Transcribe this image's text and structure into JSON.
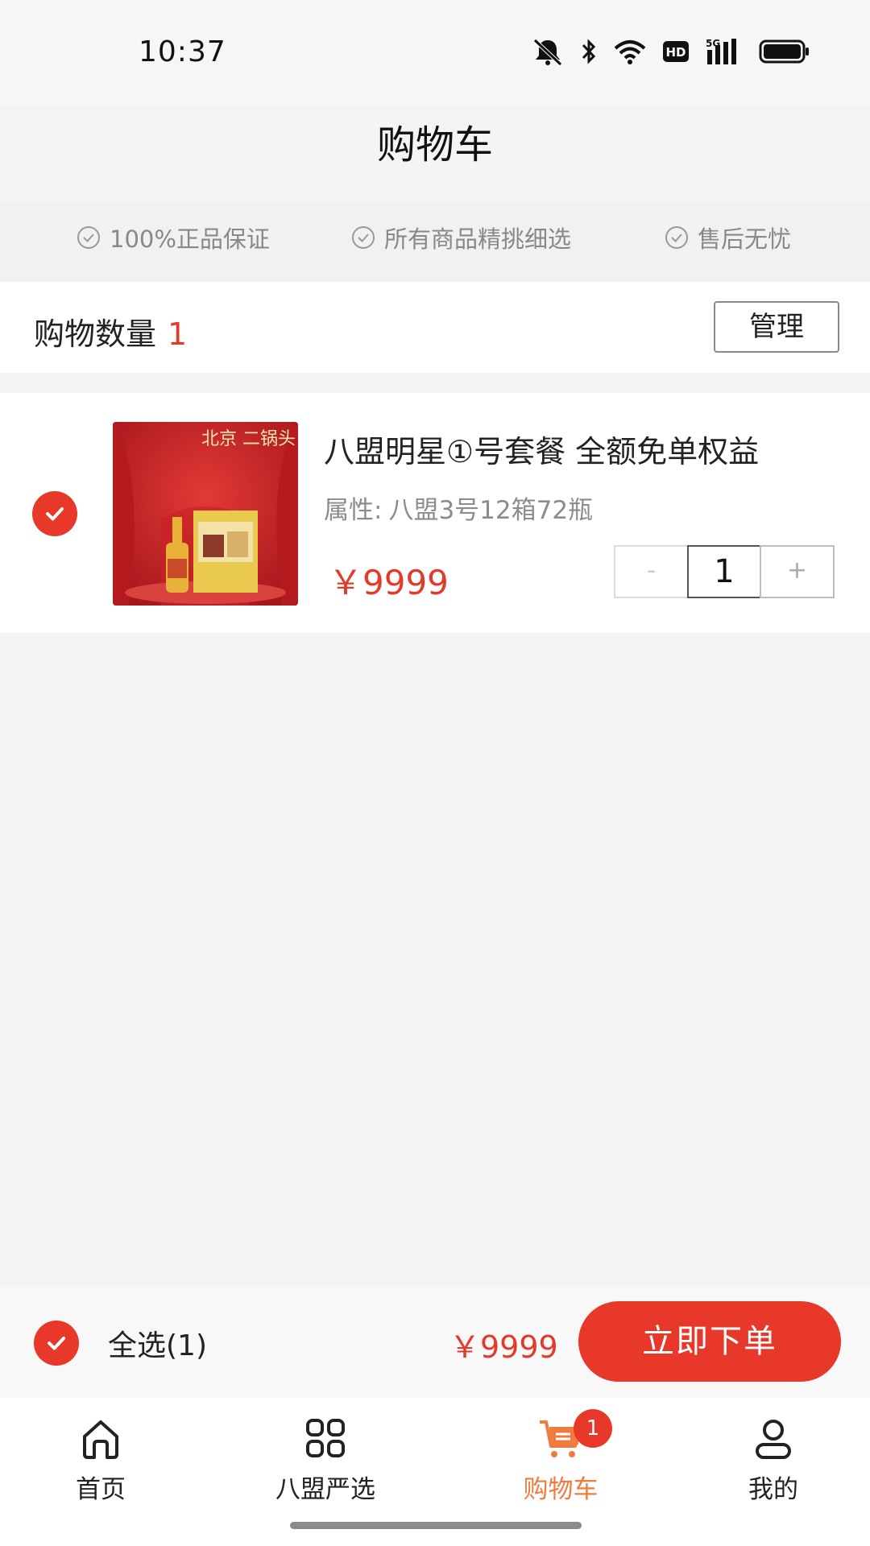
{
  "status_bar": {
    "time": "10:37",
    "icons": [
      "mute-bell-icon",
      "bluetooth-icon",
      "wifi-icon",
      "hd-icon",
      "5g-signal-icon",
      "battery-icon"
    ],
    "hd_label": "HD",
    "network_label": "5G"
  },
  "header": {
    "title": "购物车"
  },
  "guarantees": [
    {
      "icon": "check-circle-outline-icon",
      "label": "100%正品保证"
    },
    {
      "icon": "check-circle-outline-icon",
      "label": "所有商品精挑细选"
    },
    {
      "icon": "check-circle-outline-icon",
      "label": "售后无忧"
    }
  ],
  "cart_summary": {
    "count_label": "购物数量",
    "count_value": "1",
    "manage_label": "管理"
  },
  "cart_items": [
    {
      "selected": true,
      "title": "八盟明星①号套餐 全额免单权益",
      "attr_key": "属性:",
      "attr_value": "八盟3号12箱72瓶",
      "price": "￥9999",
      "quantity": "1",
      "minus_label": "-",
      "plus_label": "+",
      "image_text": "北京 二锅头"
    }
  ],
  "checkout": {
    "select_all_label": "全选(1)",
    "total_price": "￥9999",
    "order_label": "立即下单"
  },
  "tabs": [
    {
      "icon": "home-icon",
      "label": "首页",
      "active": false
    },
    {
      "icon": "grid-icon",
      "label": "八盟严选",
      "active": false
    },
    {
      "icon": "cart-icon",
      "label": "购物车",
      "active": true,
      "badge": "1"
    },
    {
      "icon": "user-icon",
      "label": "我的",
      "active": false
    }
  ],
  "colors": {
    "accent": "#e8382a",
    "active_tab": "#f07b3f",
    "background": "#f4f4f4"
  }
}
